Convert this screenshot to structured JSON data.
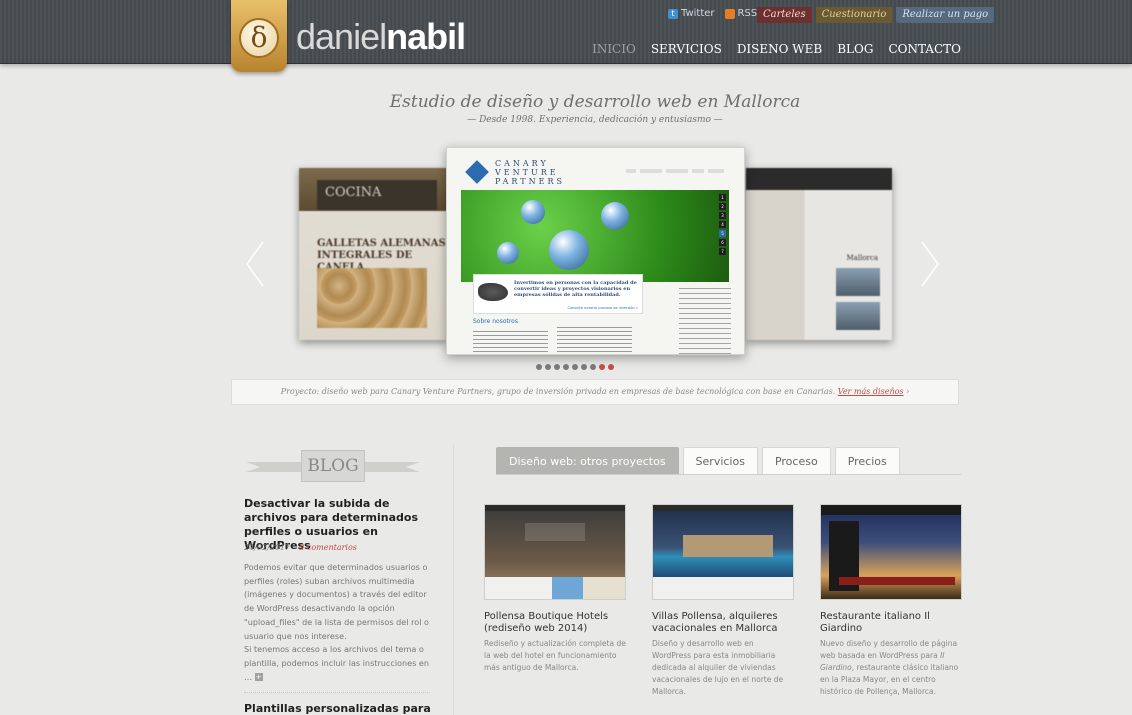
{
  "header": {
    "logo_symbol": "δ",
    "logo_light": "daniel",
    "logo_bold": "nabil",
    "top_links": [
      {
        "label": "Twitter",
        "icon": "twitter-icon"
      },
      {
        "label": "RSS",
        "icon": "rss-icon"
      }
    ],
    "pill_buttons": [
      "Carteles",
      "Cuestionario",
      "Realizar un pago"
    ],
    "nav": [
      "INICIO",
      "SERVICIOS",
      "DISENO WEB",
      "BLOG",
      "CONTACTO"
    ],
    "nav_active": "INICIO"
  },
  "hero": {
    "title": "Estudio de diseño y desarrollo web en Mallorca",
    "subtitle": "— Desde 1998. Experiencia, dedicación y entusiasmo —"
  },
  "slider": {
    "left_slide": {
      "heading": "COCINA",
      "title": "GALLETAS ALEMANAS INTEGRALES DE CANELA"
    },
    "center_slide": {
      "brand": "CANARY VENTURE PARTNERS",
      "tagline": "Invertimos en personas con la capacidad de convertir ideas y proyectos visionarios en empresas sólidas de alta rentabilidad.",
      "more": "Consulte nuestro proceso de inversión »",
      "about": "Sobre nosotros"
    },
    "right_slide": {
      "label": "Mallorca"
    },
    "dot_count": 9,
    "active_dots": [
      7,
      8
    ]
  },
  "caption": {
    "text": "Proyecto: diseño web para Canary Venture Partners, grupo de inversión privada en empresas de base tecnológica con base en Canarias.",
    "link": "Ver más diseños",
    "suffix": " ›"
  },
  "blog": {
    "label": "BLOG",
    "post1": {
      "title": "Desactivar la subida de archivos para determinados perfiles o usuarios en WordPress",
      "date": "24/02/2017 – ",
      "comments": "2 comentarios",
      "body1": "Podemos evitar que determinados usuarios o perfiles (roles) suban archivos multimedia (imágenes y documentos) a través del editor de WordPress desactivando la opción \"upload_files\" de la lista de permisos del rol o usuario que nos interese.",
      "body2": "Si tenemos acceso a los archivos del tema o plantilla, podemos incluir las instrucciones en …",
      "more_icon": "+"
    },
    "post2": {
      "title": "Plantillas personalizadas para"
    }
  },
  "tabs": [
    {
      "label": "Diseño web: otros proyectos",
      "active": true
    },
    {
      "label": "Servicios",
      "active": false
    },
    {
      "label": "Proceso",
      "active": false
    },
    {
      "label": "Precios",
      "active": false
    }
  ],
  "projects": [
    {
      "title": "Pollensa Boutique Hotels (rediseño web 2014)",
      "desc": "Rediseño y actualización completa de la web del hotel en funcionamiento más antiguo de Mallorca."
    },
    {
      "title": "Villas Pollensa, alquileres vacacionales en Mallorca",
      "desc": "Diseño y desarrollo web en WordPress para esta inmobiliaria dedicada al alquiler de viviendas vacacionales de lujo en el norte de Mallorca."
    },
    {
      "title": "Restaurante italiano Il Giardino",
      "desc_pre": "Nuevo diseño y desarrollo de página web basada en WordPress para ",
      "desc_em": "Il Giardino",
      "desc_post": ", restaurante clásico italiano en la Plaza Mayor, en el centro histórico de Pollença, Mallorca."
    }
  ],
  "colors": {
    "header_bg": "#4a4f54",
    "accent_red": "#c64a46",
    "tab_active": "#b4b4b0",
    "page_bg": "#e9e9e7"
  }
}
